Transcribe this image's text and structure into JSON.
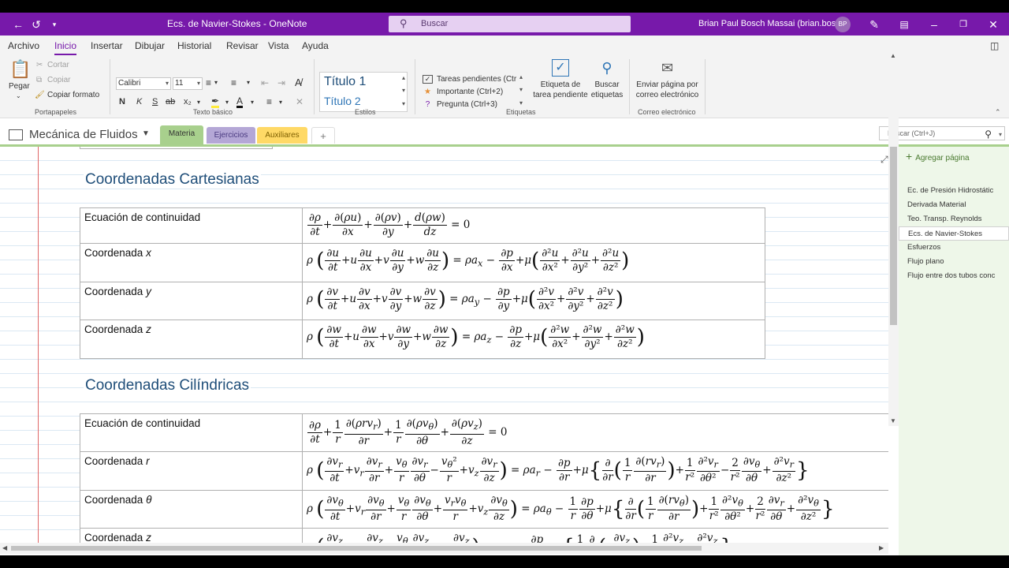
{
  "window": {
    "title": "Ecs. de Navier-Stokes  -  OneNote",
    "search_placeholder": "Buscar",
    "user": "Brian Paul Bosch Massai (brian.bosch)",
    "avatar": "BP"
  },
  "menu": [
    "Archivo",
    "Inicio",
    "Insertar",
    "Dibujar",
    "Historial",
    "Revisar",
    "Vista",
    "Ayuda"
  ],
  "ribbon": {
    "clipboard": {
      "paste": "Pegar",
      "cut": "Cortar",
      "copy": "Copiar",
      "format_painter": "Copiar formato",
      "label": "Portapapeles"
    },
    "basic_text": {
      "font": "Calibri",
      "size": "11",
      "label": "Texto básico"
    },
    "styles": {
      "style1": "Título 1",
      "style2": "Título 2",
      "label": "Estilos"
    },
    "tags": {
      "items": [
        "Tareas pendientes (Ctr",
        "Importante (Ctrl+2)",
        "Pregunta (Ctrl+3)"
      ],
      "todo_tag": "Etiqueta de tarea pendiente",
      "find_tags": "Buscar etiquetas",
      "label": "Etiquetas"
    },
    "email": {
      "send": "Enviar página por correo electrónico",
      "label": "Correo electrónico"
    }
  },
  "notebook": {
    "name": "Mecánica de Fluidos",
    "sections": [
      "Materia",
      "Ejercicios",
      "Auxiliares"
    ],
    "add_section": "+",
    "search_placeholder": "Buscar (Ctrl+J)"
  },
  "pages_panel": {
    "add_page": "Agregar página",
    "pages": [
      "Ec. de Presión Hidrostátic",
      "Derivada Material",
      "Teo. Transp. Reynolds",
      "Ecs. de Navier-Stokes",
      "Esfuerzos",
      "Flujo plano",
      "Flujo entre dos tubos conc"
    ],
    "selected": "Ecs. de Navier-Stokes"
  },
  "content": {
    "cartesian": {
      "heading": "Coordenadas Cartesianas",
      "rows": [
        "Ecuación de continuidad",
        "Coordenada x",
        "Coordenada y",
        "Coordenada z"
      ]
    },
    "cylindrical": {
      "heading": "Coordenadas Cilíndricas",
      "rows": [
        "Ecuación de continuidad",
        "Coordenada r",
        "Coordenada θ",
        "Coordenada z"
      ]
    }
  },
  "colors": {
    "accent": "#7719aa",
    "materia_tab": "#a8d08d",
    "ejercicios_tab": "#b4a7d6",
    "auxiliares_tab": "#ffd966",
    "heading": "#1f4e79"
  }
}
